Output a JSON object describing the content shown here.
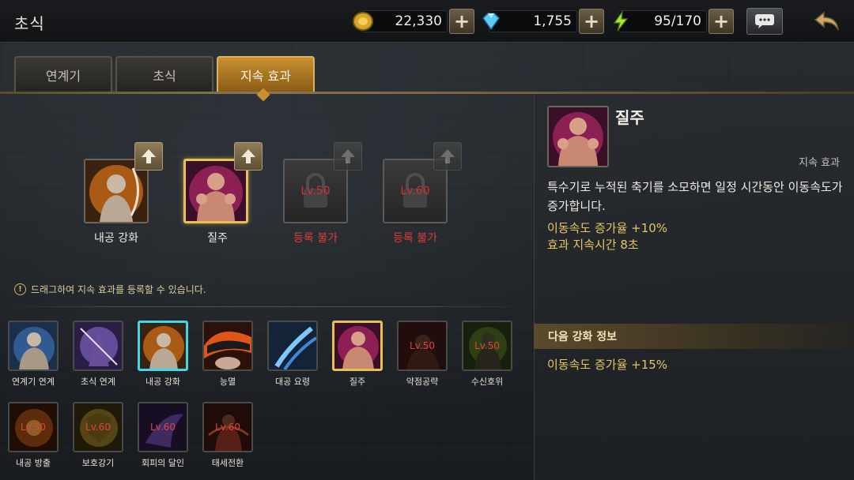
{
  "header": {
    "title": "초식",
    "gold": "22,330",
    "gems": "1,755",
    "stamina": "95/170",
    "plus_label": "+"
  },
  "tabs": [
    {
      "label": "연계기",
      "active": false
    },
    {
      "label": "초식",
      "active": false
    },
    {
      "label": "지속 효과",
      "active": true
    }
  ],
  "equipped_slots": [
    {
      "label": "내공 강화",
      "locked": false,
      "selected": false,
      "icon": "flaming-warrior-icon"
    },
    {
      "label": "질주",
      "locked": false,
      "selected": true,
      "icon": "pink-warrior-icon"
    },
    {
      "label": "등록 불가",
      "locked": true,
      "level": "Lv.50",
      "icon": "lock-icon"
    },
    {
      "label": "등록 불가",
      "locked": true,
      "level": "Lv.60",
      "icon": "lock-icon"
    }
  ],
  "notice": "드래그하여 지속 효과를 등록할 수 있습니다.",
  "skills_row1": [
    {
      "label": "연계기 연계",
      "icon": "blue-warrior-icon",
      "border": "none"
    },
    {
      "label": "초식 연계",
      "icon": "purple-strike-icon",
      "border": "none"
    },
    {
      "label": "내공 강화",
      "icon": "flaming-warrior-icon",
      "border": "cyan"
    },
    {
      "label": "능멸",
      "icon": "fire-mask-icon",
      "border": "none"
    },
    {
      "label": "대공 요령",
      "icon": "blue-slash-icon",
      "border": "none"
    },
    {
      "label": "질주",
      "icon": "pink-warrior-icon",
      "border": "gold"
    },
    {
      "label": "약점공략",
      "icon": "dark-warrior-icon",
      "border": "none",
      "level": "Lv.50"
    },
    {
      "label": "수신호위",
      "icon": "green-guard-icon",
      "border": "none",
      "level": "Lv.50"
    }
  ],
  "skills_row2": [
    {
      "label": "내공 방출",
      "icon": "fire-burst-icon",
      "level": "Lv.50"
    },
    {
      "label": "보호강기",
      "icon": "gold-shield-icon",
      "level": "Lv.60"
    },
    {
      "label": "회피의 달인",
      "icon": "purple-dodge-icon",
      "level": "Lv.60"
    },
    {
      "label": "태세전환",
      "icon": "red-stance-icon",
      "level": "Lv.60"
    }
  ],
  "detail": {
    "name": "질주",
    "type": "지속 효과",
    "description": "특수기로 누적된 축기를 소모하면 일정 시간동안 이동속도가 증가합니다.",
    "stat1": "이동속도 증가율 +10%",
    "stat2": "효과 지속시간 8초",
    "next_header": "다음 강화 정보",
    "next_stat": "이동속도 증가율 +15%"
  }
}
